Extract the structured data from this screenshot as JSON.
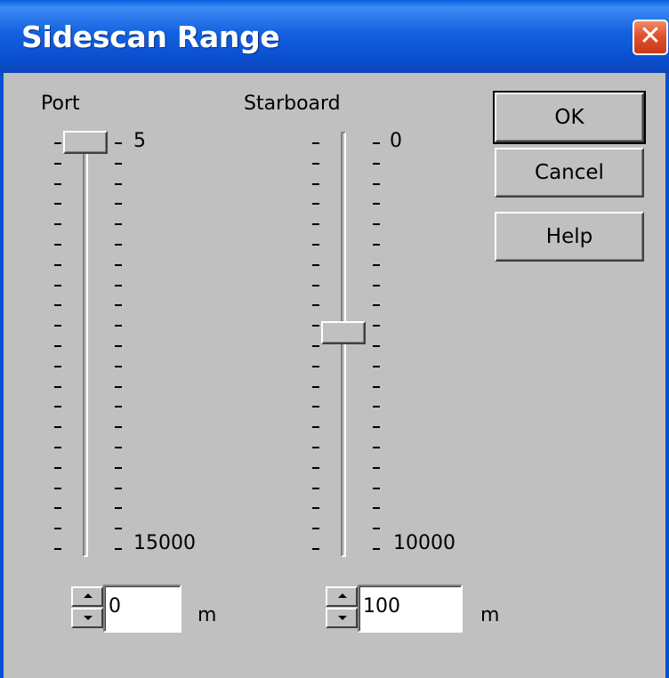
{
  "window": {
    "title": "Sidescan Range"
  },
  "port": {
    "label": "Port",
    "max_label": "5",
    "min_label": "15000",
    "value": "0",
    "unit": "m",
    "slider_fraction": 0.0
  },
  "starboard": {
    "label": "Starboard",
    "max_label": "0",
    "min_label": "10000",
    "value": "100",
    "unit": "m",
    "slider_fraction": 0.47
  },
  "buttons": {
    "ok": "OK",
    "cancel": "Cancel",
    "help": "Help"
  },
  "icons": {
    "close": "close-icon",
    "spin_up": "arrow-up-icon",
    "spin_down": "arrow-down-icon"
  },
  "colors": {
    "titlebar": "#0a4fd0",
    "close_button": "#e2512b",
    "dialog_bg": "#c0c0c0"
  }
}
